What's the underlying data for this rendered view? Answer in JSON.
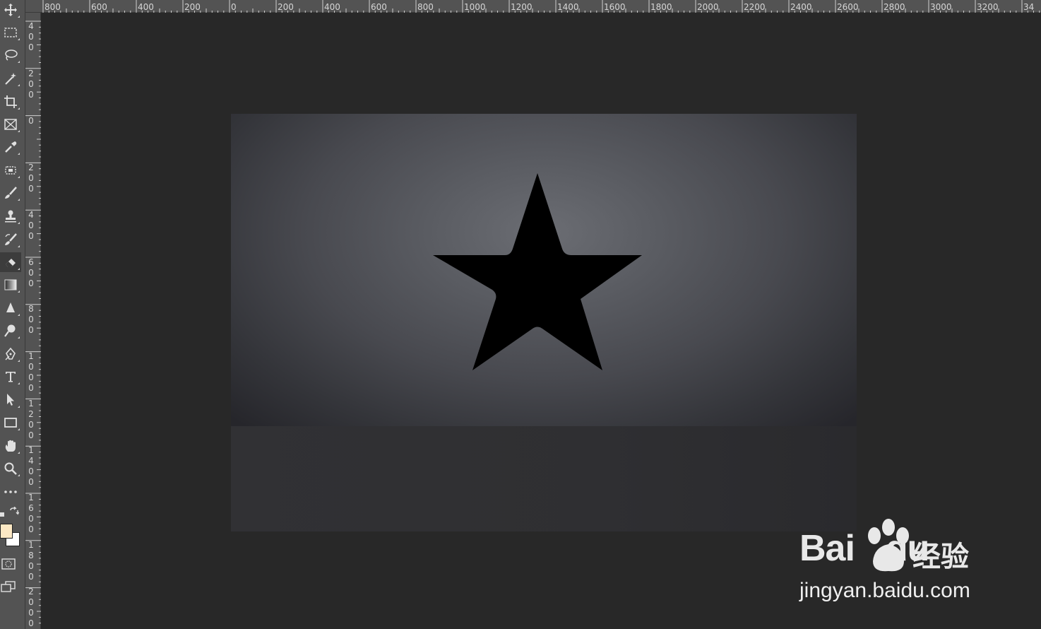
{
  "window": {
    "app": "Photoshop"
  },
  "toolbar": {
    "active_tool": "eraser",
    "foreground_color": "#fce8c4",
    "background_color": "#ffffff",
    "tools": [
      {
        "name": "move-tool",
        "icon": "move-icon"
      },
      {
        "name": "marquee-tool",
        "icon": "rectangular-marquee-icon"
      },
      {
        "name": "lasso-tool",
        "icon": "lasso-icon"
      },
      {
        "name": "magic-wand-tool",
        "icon": "magic-wand-icon"
      },
      {
        "name": "crop-tool",
        "icon": "crop-icon"
      },
      {
        "name": "frame-tool",
        "icon": "frame-icon"
      },
      {
        "name": "eyedropper-tool",
        "icon": "eyedropper-icon"
      },
      {
        "name": "patch-tool",
        "icon": "patch-icon"
      },
      {
        "name": "brush-tool",
        "icon": "brush-icon"
      },
      {
        "name": "stamp-tool",
        "icon": "stamp-icon"
      },
      {
        "name": "history-brush-tool",
        "icon": "history-brush-icon"
      },
      {
        "name": "eraser-tool",
        "icon": "eraser-icon"
      },
      {
        "name": "gradient-tool",
        "icon": "gradient-icon"
      },
      {
        "name": "blur-tool",
        "icon": "blur-icon"
      },
      {
        "name": "dodge-tool",
        "icon": "dodge-icon"
      },
      {
        "name": "pen-tool",
        "icon": "pen-icon"
      },
      {
        "name": "type-tool",
        "icon": "type-icon"
      },
      {
        "name": "path-selection-tool",
        "icon": "path-selection-icon"
      },
      {
        "name": "rectangle-tool",
        "icon": "rectangle-icon"
      },
      {
        "name": "hand-tool",
        "icon": "hand-icon"
      },
      {
        "name": "zoom-tool",
        "icon": "zoom-icon"
      },
      {
        "name": "more-tools",
        "icon": "ellipsis-icon"
      }
    ]
  },
  "rulers": {
    "top_labels": [
      "800",
      "600",
      "400",
      "200",
      "0",
      "200",
      "400",
      "600",
      "800",
      "1000",
      "1200",
      "1400",
      "1600",
      "1800",
      "2000",
      "2200",
      "2400",
      "2600",
      "2800",
      "3000",
      "3200",
      "34"
    ],
    "left_labels": [
      "400",
      "200",
      "0",
      "200",
      "400",
      "600",
      "800",
      "1000",
      "1200",
      "1400",
      "1600",
      "1800",
      "2000"
    ]
  },
  "canvas": {
    "shape": "star",
    "shape_fill": "#000000",
    "background_tone": "#5b5d63"
  },
  "watermark": {
    "brand_prefix": "Bai",
    "brand_suffix": "du",
    "brand_cn": "经验",
    "url": "jingyan.baidu.com"
  }
}
